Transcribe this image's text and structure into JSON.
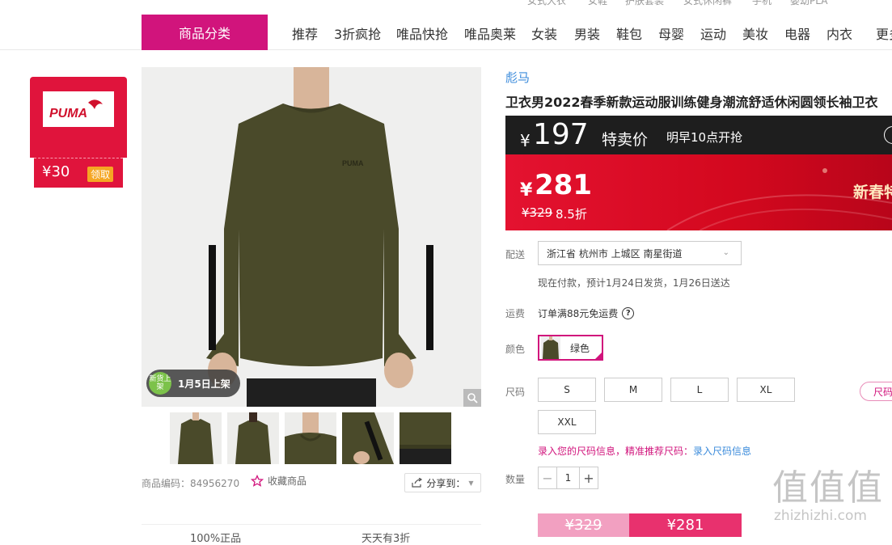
{
  "top_strip": [
    "女式大衣",
    "女鞋",
    "护肤套装",
    "女式休闲裤",
    "手机",
    "婴幼PLA"
  ],
  "nav": {
    "category_button": "商品分类",
    "items": [
      "推荐",
      "3折疯抢",
      "唯品快抢",
      "唯品奥莱",
      "女装",
      "男装",
      "鞋包",
      "母婴",
      "运动",
      "美妆",
      "电器",
      "内衣",
      "更多"
    ]
  },
  "brand_coupon": {
    "logo_text": "PUMA",
    "amount": "¥30",
    "action": "领取"
  },
  "gallery": {
    "badge_circle": "新货上架",
    "badge_text": "1月5日上架",
    "thumbnail_count": 5
  },
  "product_meta": {
    "code_label": "商品编码：84956270",
    "favorite": "收藏商品",
    "share": "分享到："
  },
  "bottom_tags": [
    "100%正品",
    "天天有3折"
  ],
  "product": {
    "brand": "彪马",
    "title": "卫衣男2022春季新款运动服训练健身潮流舒适休闲圆领长袖卫衣"
  },
  "price": {
    "special_currency": "¥",
    "special_price": "197",
    "special_label": "特卖价",
    "special_time": "明早10点开抢",
    "current_currency": "¥",
    "current_price": "281",
    "original_price": "¥329",
    "discount": "8.5折",
    "promo_text": "新春特"
  },
  "delivery": {
    "label": "配送",
    "address": "浙江省 杭州市 上城区 南星街道",
    "info": "现在付款，预计1月24日发货，1月26日送达"
  },
  "shipping": {
    "label": "运费",
    "text": "订单满88元免运费",
    "help": "?"
  },
  "color": {
    "label": "颜色",
    "selected": "绿色"
  },
  "size": {
    "label": "尺码",
    "options": [
      "S",
      "M",
      "L",
      "XL",
      "XXL"
    ],
    "guide": "尺码",
    "tip_prefix": "录入您的尺码信息，精准推荐尺码：",
    "tip_link": "录入尺码信息"
  },
  "quantity": {
    "label": "数量",
    "minus": "−",
    "value": "1",
    "plus": "+"
  },
  "buy_buttons": {
    "original": "¥329",
    "current": "¥281"
  },
  "watermark": {
    "big": "值值值",
    "small": "zhizhizhi.com"
  },
  "colors": {
    "accent": "#d1147c",
    "price_red": "#e41230",
    "link": "#3b8bdb",
    "sweater": "#4a4a2a"
  }
}
